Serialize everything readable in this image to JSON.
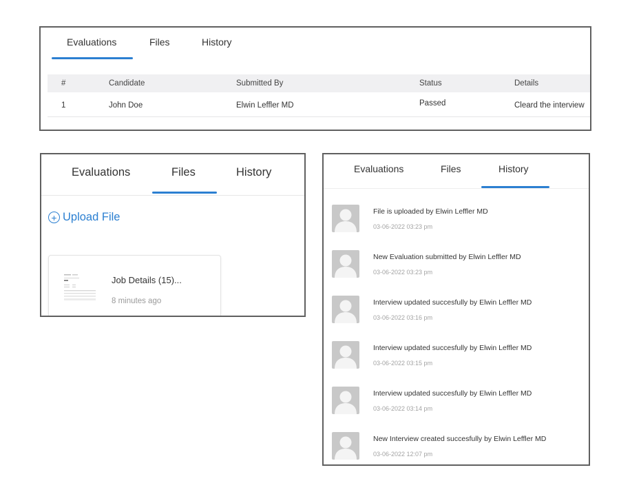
{
  "panel1": {
    "tabs": [
      "Evaluations",
      "Files",
      "History"
    ],
    "table": {
      "headers": [
        "#",
        "Candidate",
        "Submitted By",
        "Status",
        "Details"
      ],
      "rows": [
        [
          "1",
          "John Doe",
          "Elwin Leffler MD",
          "Passed",
          "Cleard the interview"
        ]
      ]
    }
  },
  "panel2": {
    "tabs": [
      "Evaluations",
      "Files",
      "History"
    ],
    "upload_label": "Upload File",
    "file": {
      "name": "Job Details (15)...",
      "time": "8 minutes ago"
    }
  },
  "panel3": {
    "tabs": [
      "Evaluations",
      "Files",
      "History"
    ],
    "items": [
      {
        "text": "File is uploaded by Elwin Leffler MD",
        "time": "03-06-2022 03:23 pm"
      },
      {
        "text": "New Evaluation submitted by Elwin Leffler MD",
        "time": "03-06-2022 03:23 pm"
      },
      {
        "text": "Interview updated succesfully by Elwin Leffler MD",
        "time": "03-06-2022 03:16 pm"
      },
      {
        "text": "Interview updated succesfully by Elwin Leffler MD",
        "time": "03-06-2022 03:15 pm"
      },
      {
        "text": "Interview updated succesfully by Elwin Leffler MD",
        "time": "03-06-2022 03:14 pm"
      },
      {
        "text": "New Interview created succesfully by Elwin Leffler MD",
        "time": "03-06-2022 12:07 pm"
      }
    ]
  },
  "colors": {
    "accent": "#2b7fd1",
    "border": "#5f5f5f",
    "header_bg": "#f0f0f2",
    "muted": "#9a9a9a"
  },
  "icons": {
    "upload": "plus-circle-icon",
    "avatar": "user-avatar-icon",
    "file": "document-thumbnail-icon"
  }
}
